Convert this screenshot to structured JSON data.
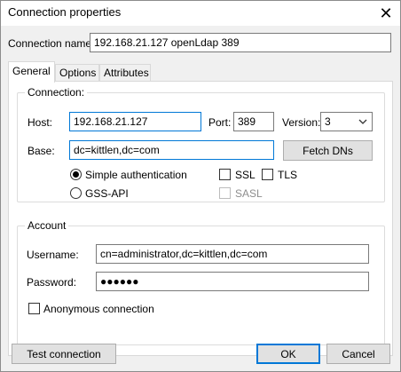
{
  "window": {
    "title": "Connection properties",
    "close_glyph": "✕"
  },
  "connection_name": {
    "label": "Connection name:",
    "value": "192.168.21.127  openLdap 389"
  },
  "tabs": [
    {
      "label": "General",
      "active": true
    },
    {
      "label": "Options",
      "active": false
    },
    {
      "label": "Attributes",
      "active": false
    }
  ],
  "connection_group": {
    "legend": "Connection:",
    "host_label": "Host:",
    "host_value": "192.168.21.127",
    "port_label": "Port:",
    "port_value": "389",
    "version_label": "Version:",
    "version_value": "3",
    "base_label": "Base:",
    "base_value": "dc=kittlen,dc=com",
    "fetch_dns_label": "Fetch DNs",
    "auth_simple_label": "Simple authentication",
    "auth_simple_checked": true,
    "auth_gssapi_label": "GSS-API",
    "auth_gssapi_checked": false,
    "ssl_label": "SSL",
    "tls_label": "TLS",
    "sasl_label": "SASL"
  },
  "account_group": {
    "legend": "Account",
    "username_label": "Username:",
    "username_value": "cn=administrator,dc=kittlen,dc=com",
    "password_label": "Password:",
    "password_value": "●●●●●●",
    "anonymous_label": "Anonymous connection"
  },
  "footer": {
    "test_label": "Test connection",
    "ok_label": "OK",
    "cancel_label": "Cancel"
  },
  "colors": {
    "focus_border": "#0078d7",
    "dialog_bg": "#f0f0f0"
  }
}
